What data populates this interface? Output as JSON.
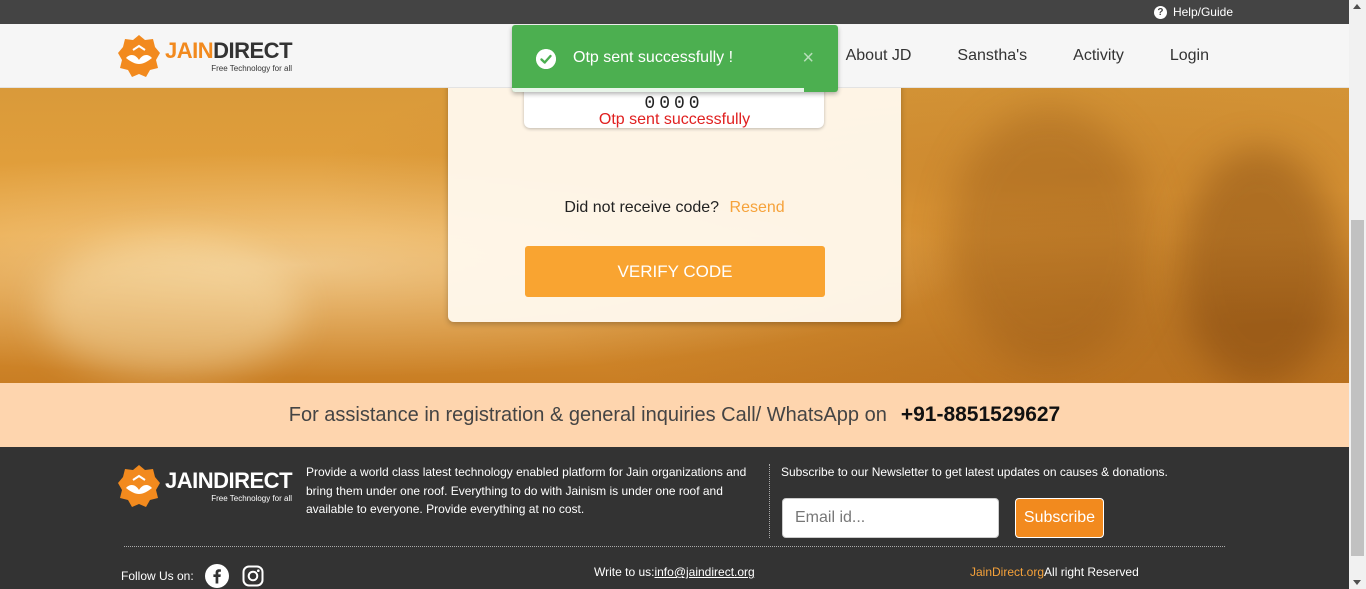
{
  "topbar": {
    "help_label": "Help/Guide",
    "help_icon": "question-circle-icon"
  },
  "brand": {
    "name_part1": "JAIN",
    "name_part2": "DIRECT",
    "tagline": "Free Technology for all",
    "accent": "#f28a1e"
  },
  "nav": {
    "items": [
      "About JD",
      "Sanstha's",
      "Activity",
      "Login"
    ]
  },
  "toast": {
    "message": "Otp sent successfully !",
    "close": "×",
    "color": "#4caf50",
    "icon": "check-circle-icon"
  },
  "otp": {
    "value": "0000",
    "status": "Otp sent successfully",
    "resend_prompt": "Did not receive code?",
    "resend_label": "Resend",
    "verify_label": "VERIFY CODE"
  },
  "assist": {
    "text": "For assistance in registration & general inquiries Call/ WhatsApp on",
    "phone": "+91-8851529627"
  },
  "footer": {
    "about": "Provide a world class latest technology enabled platform for Jain organizations and bring them under one roof. Everything to do with Jainism is under one roof and available to everyone. Provide everything at no cost.",
    "newsletter_text": "Subscribe to our Newsletter to get latest updates on causes & donations.",
    "email_placeholder": "Email id...",
    "subscribe_label": "Subscribe",
    "follow_label": "Follow Us on:",
    "socials": [
      "facebook-icon",
      "instagram-icon"
    ],
    "write_label": "Write to us:",
    "email": "info@jaindirect.org",
    "org": "JainDirect.org",
    "rights": "All right Reserved"
  }
}
